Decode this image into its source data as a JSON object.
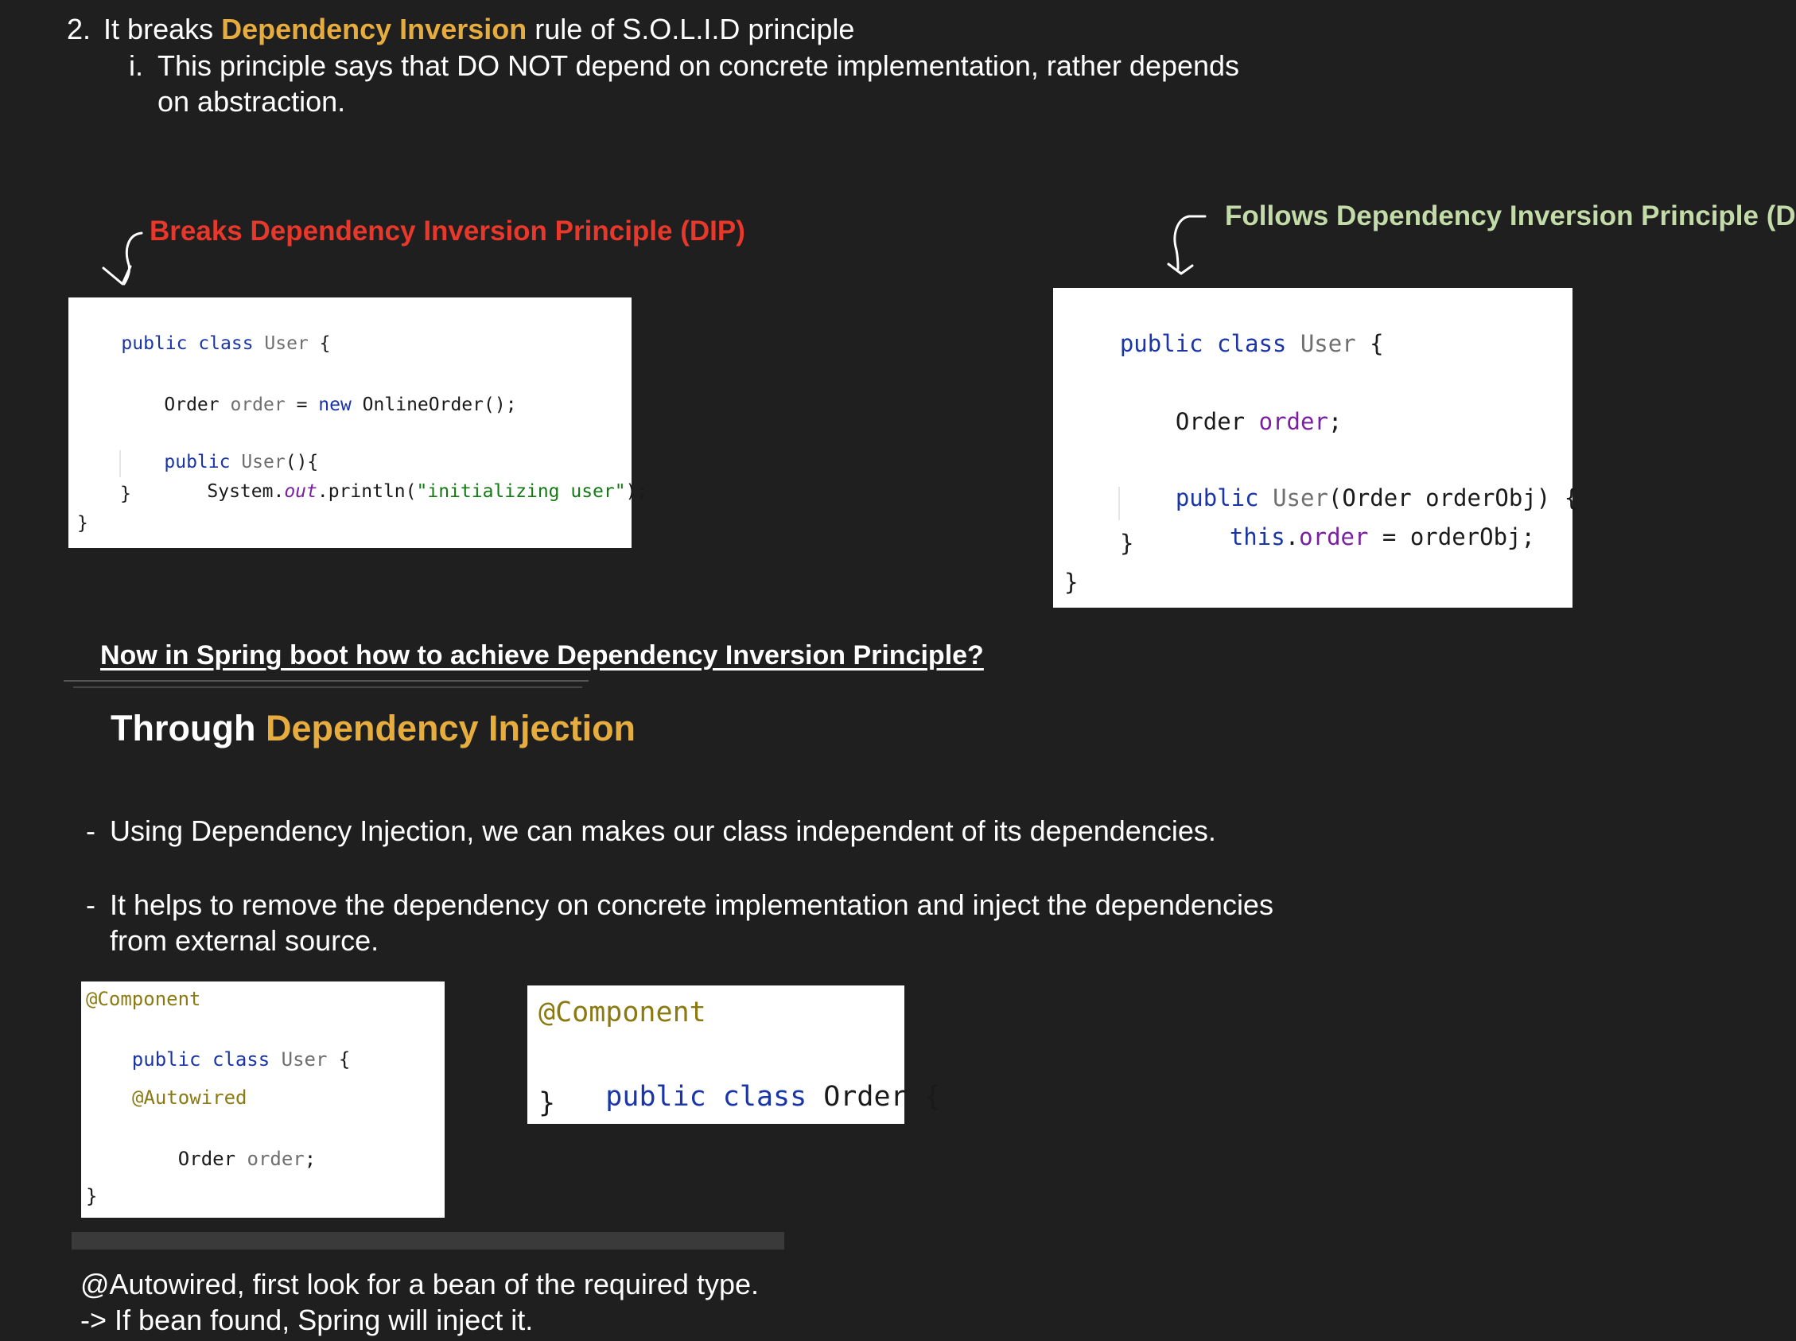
{
  "point2": {
    "number": "2.",
    "pre": "It breaks ",
    "highlight": "Dependency Inversion",
    "post": " rule of S.O.L.I.D principle",
    "sub_number": "i.",
    "sub_line1": "This principle says that DO NOT depend on concrete implementation, rather depends",
    "sub_line2": "on abstraction."
  },
  "breaks_label": "Breaks Dependency Inversion Principle (DIP)",
  "follows_label": "Follows Dependency Inversion Principle (DIP)",
  "code_breaks": {
    "l1_kw": "public class ",
    "l1_cls": "User",
    "l1_end": " {",
    "l2_type": "Order ",
    "l2_var": "order",
    "l2_eq": " = ",
    "l2_new": "new",
    "l2_rest": " OnlineOrder();",
    "l3_kw": "public ",
    "l3_cls": "User",
    "l3_end": "(){",
    "l4_sys": "System.",
    "l4_out": "out",
    "l4_mid": ".println(",
    "l4_str": "\"initializing user\"",
    "l4_end": ");",
    "l5": "}",
    "l6": "}"
  },
  "code_follows": {
    "l1_kw": "public class ",
    "l1_cls": "User",
    "l1_end": " {",
    "l2_type": "Order ",
    "l2_var": "order",
    "l2_end": ";",
    "l3_kw": "public ",
    "l3_cls": "User",
    "l3_end": "(Order orderObj) {",
    "l4_this": "this",
    "l4_dot": ".",
    "l4_fld": "order",
    "l4_end": " = orderObj;",
    "l5": "}",
    "l6": "}"
  },
  "question": "Now in Spring boot how to achieve Dependency Inversion Principle?",
  "through": {
    "pre": "Through ",
    "highlight": "Dependency Injection"
  },
  "bullets": [
    {
      "dash": "-",
      "line1": "Using Dependency Injection, we can makes our class independent of its dependencies.",
      "line2": ""
    },
    {
      "dash": "-",
      "line1": "It helps to remove the dependency on concrete implementation and inject the dependencies",
      "line2": "from external source."
    }
  ],
  "code_user": {
    "l1": "@Component",
    "l2_kw": "public class ",
    "l2_cls": "User",
    "l2_end": " {",
    "l3": "@Autowired",
    "l4_type": "Order ",
    "l4_var": "order",
    "l4_end": ";",
    "l5": "}"
  },
  "code_order": {
    "l1": "@Component",
    "l2_kw": "public class ",
    "l2_cls": "Order",
    "l2_end": " {",
    "l3": "}"
  },
  "autowired_note": {
    "line1": "@Autowired, first look for a bean of the required type.",
    "line2": "-> If bean found, Spring will inject it."
  }
}
